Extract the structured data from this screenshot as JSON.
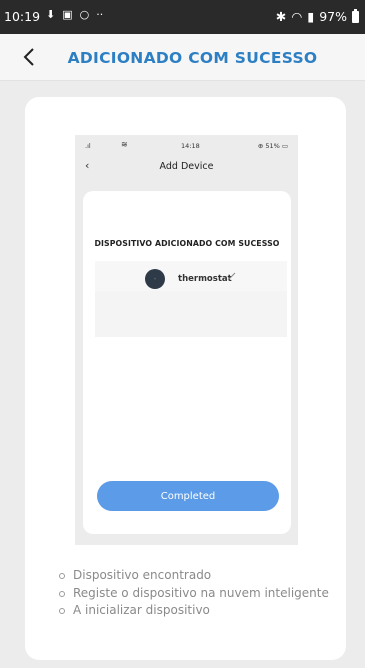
{
  "statusbar": {
    "time": "10:19",
    "battery": "97%"
  },
  "appbar": {
    "title": "ADICIONADO COM SUCESSO"
  },
  "mockup": {
    "status_time": "14:18",
    "status_battery": "51%",
    "nav_title": "Add Device",
    "success_title": "DISPOSITIVO ADICIONADO COM SUCESSO",
    "device_name": "thermostat",
    "completed_label": "Completed"
  },
  "steps": [
    "Dispositivo encontrado",
    "Registe o dispositivo na nuvem inteligente",
    "A inicializar dispositivo"
  ]
}
